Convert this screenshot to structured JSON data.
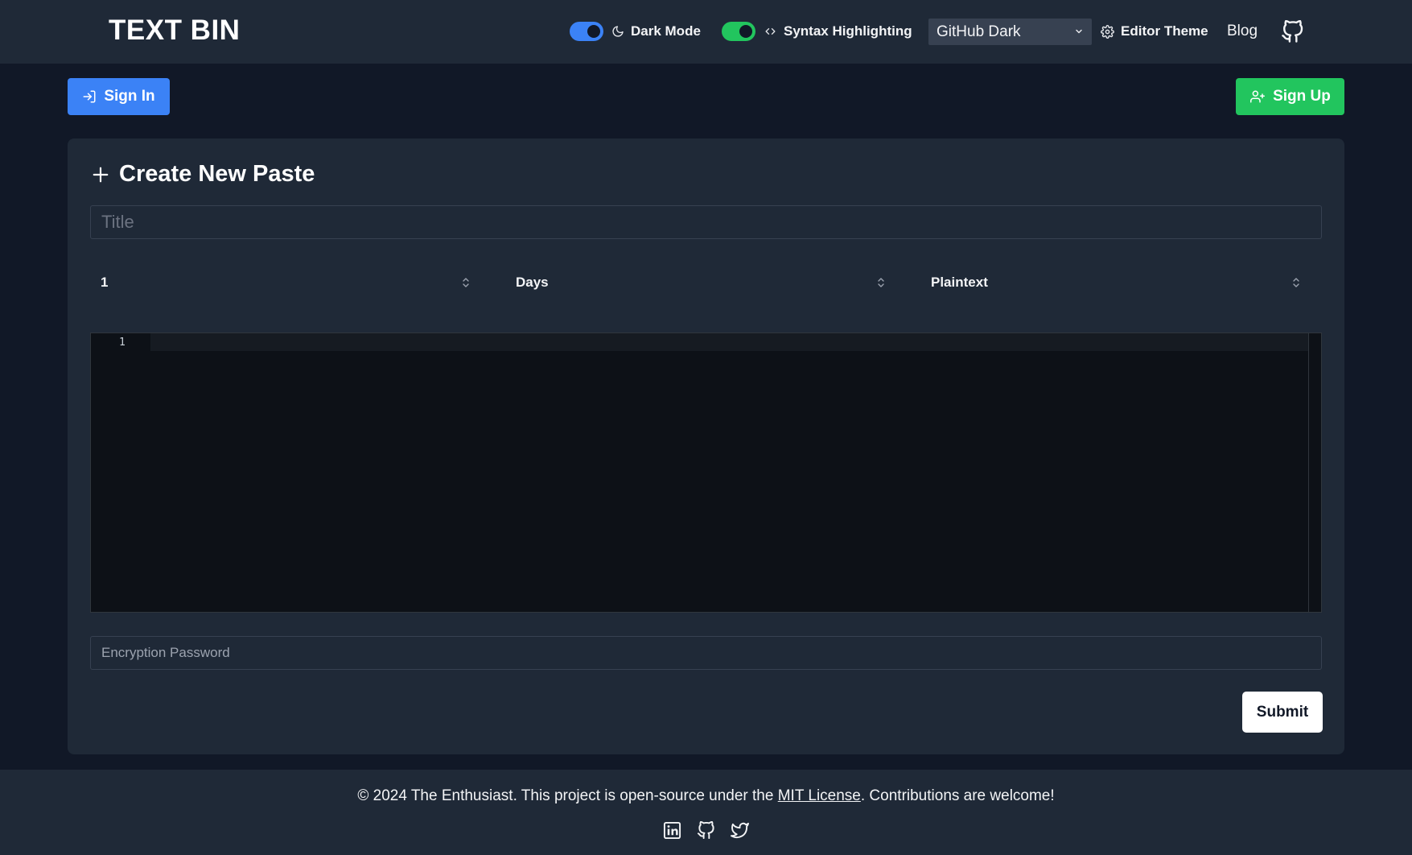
{
  "header": {
    "logo": "TEXT BIN",
    "dark_mode_label": "Dark Mode",
    "syntax_label": "Syntax Highlighting",
    "theme_value": "GitHub Dark",
    "editor_theme_label": "Editor Theme",
    "blog_label": "Blog",
    "dark_mode_on": true,
    "syntax_on": true,
    "colors": {
      "dark_toggle": "#3b82f6",
      "syntax_toggle": "#22c55e"
    }
  },
  "auth": {
    "sign_in_label": "Sign In",
    "sign_up_label": "Sign Up",
    "colors": {
      "sign_in": "#3b82f6",
      "sign_up": "#22c55e"
    }
  },
  "form": {
    "heading": "Create New Paste",
    "title_placeholder": "Title",
    "expiry_value": "1",
    "expiry_unit": "Days",
    "language": "Plaintext",
    "editor_line": "1",
    "password_placeholder": "Encryption Password",
    "submit_label": "Submit"
  },
  "footer": {
    "text_before": "© 2024 The Enthusiast. This project is open-source under the ",
    "license_link": "MIT License",
    "text_after": ". Contributions are welcome!",
    "social_icons": [
      "linkedin-icon",
      "github-icon",
      "twitter-icon"
    ]
  }
}
